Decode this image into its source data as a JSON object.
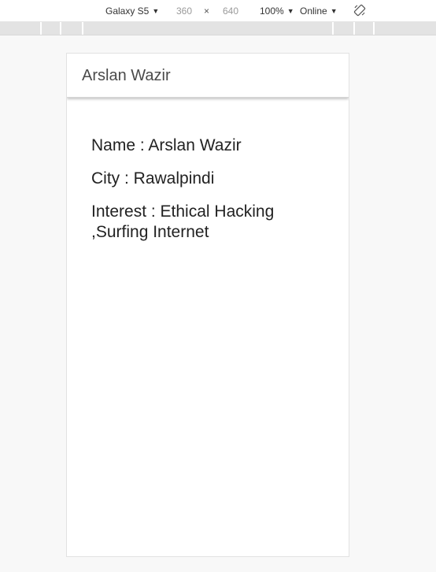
{
  "devtools": {
    "device": "Galaxy S5",
    "width": "360",
    "times": "×",
    "height": "640",
    "zoom": "100%",
    "network": "Online",
    "caret": "▼"
  },
  "app": {
    "title": "Arslan Wazir",
    "name_line": "Name : Arslan Wazir",
    "city_line": "City : Rawalpindi",
    "interest_line": "Interest : Ethical Hacking ,Surfing Internet"
  }
}
